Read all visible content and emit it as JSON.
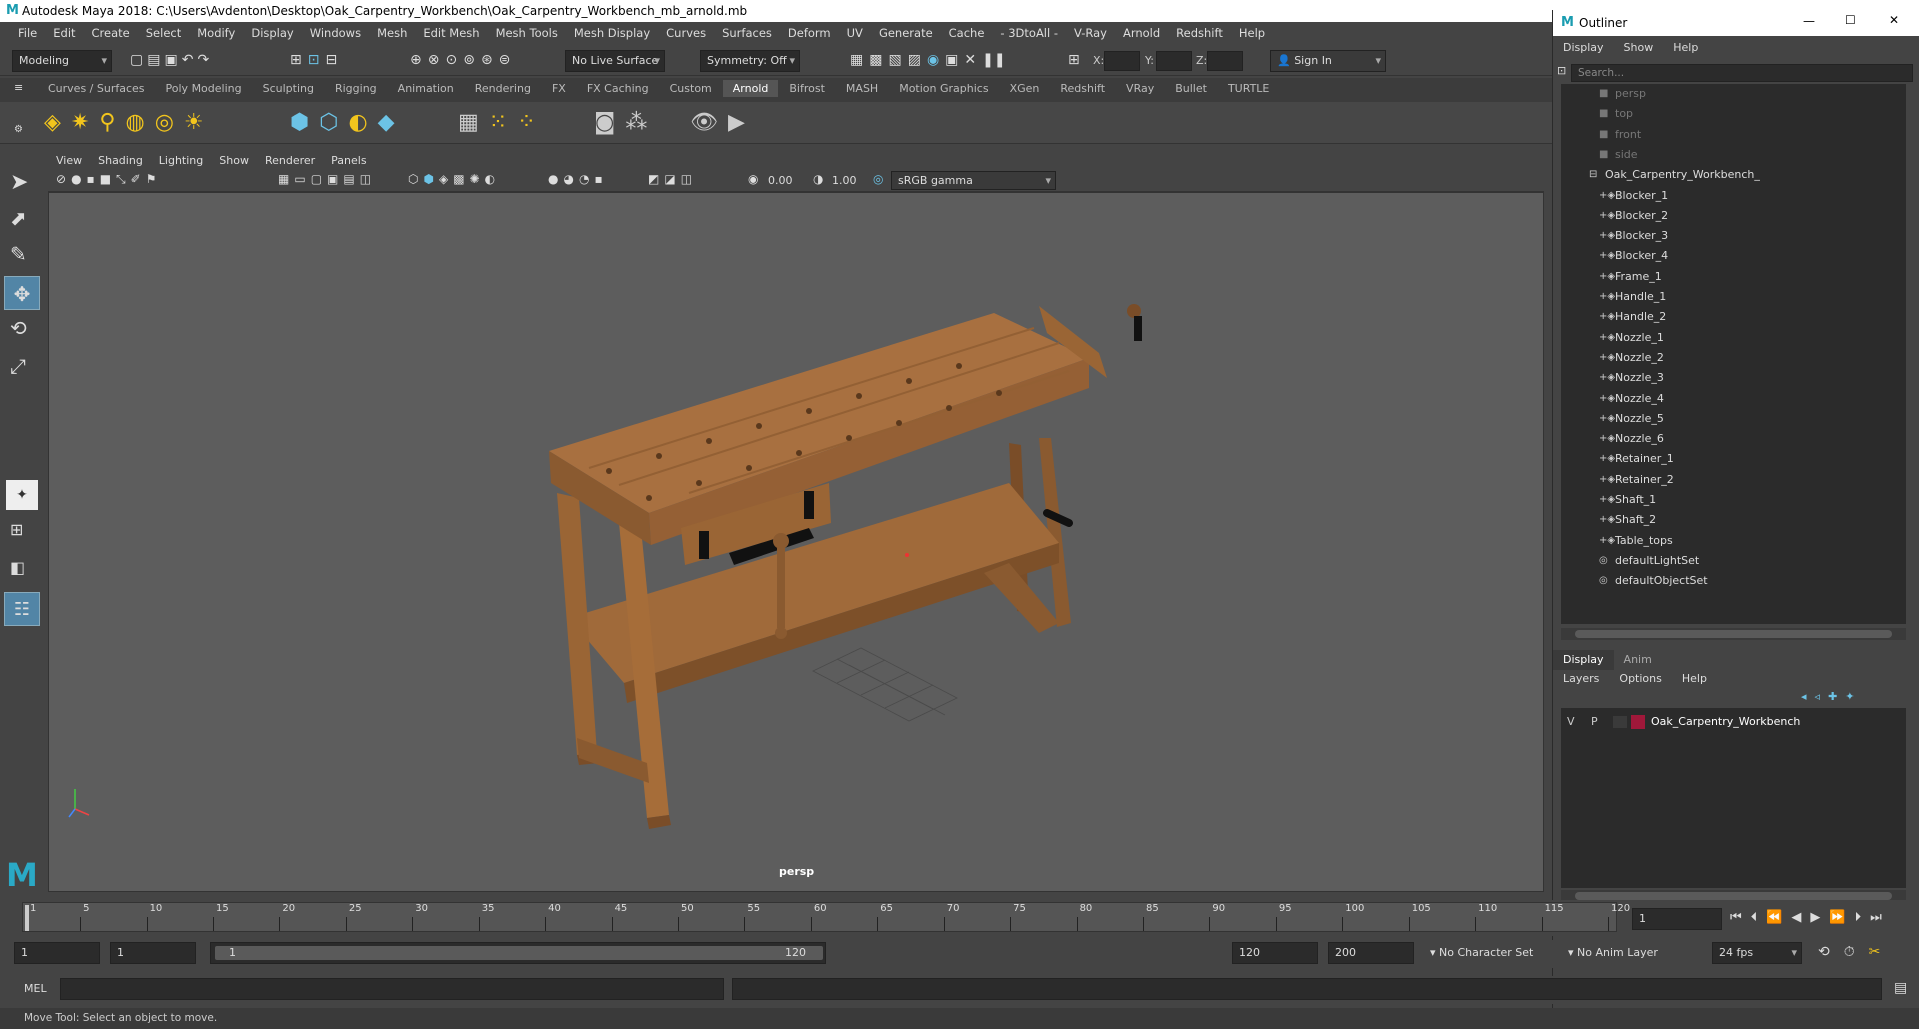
{
  "window": {
    "title": "Autodesk Maya 2018: C:\\Users\\Avdenton\\Desktop\\Oak_Carpentry_Workbench\\Oak_Carpentry_Workbench_mb_arnold.mb"
  },
  "menubar": [
    "File",
    "Edit",
    "Create",
    "Select",
    "Modify",
    "Display",
    "Windows",
    "Mesh",
    "Edit Mesh",
    "Mesh Tools",
    "Mesh Display",
    "Curves",
    "Surfaces",
    "Deform",
    "UV",
    "Generate",
    "Cache",
    "- 3DtoAll -",
    "V-Ray",
    "Arnold",
    "Redshift",
    "Help"
  ],
  "statusline": {
    "mode": "Modeling",
    "live_surface": "No Live Surface",
    "symmetry": "Symmetry: Off",
    "x_label": "X:",
    "y_label": "Y:",
    "z_label": "Z:",
    "sign_in": "Sign In"
  },
  "shelf_tabs": [
    "Curves / Surfaces",
    "Poly Modeling",
    "Sculpting",
    "Rigging",
    "Animation",
    "Rendering",
    "FX",
    "FX Caching",
    "Custom",
    "Arnold",
    "Bifrost",
    "MASH",
    "Motion Graphics",
    "XGen",
    "Redshift",
    "VRay",
    "Bullet",
    "TURTLE"
  ],
  "shelf_active": "Arnold",
  "viewport": {
    "menu": [
      "View",
      "Shading",
      "Lighting",
      "Show",
      "Renderer",
      "Panels"
    ],
    "exposure": "0.00",
    "gamma": "1.00",
    "color_space": "sRGB gamma",
    "camera_label": "persp"
  },
  "outliner": {
    "title": "Outliner",
    "menu": [
      "Display",
      "Show",
      "Help"
    ],
    "search_placeholder": "Search...",
    "cameras": [
      "persp",
      "top",
      "front",
      "side"
    ],
    "group": "Oak_Carpentry_Workbench_",
    "children": [
      "Blocker_1",
      "Blocker_2",
      "Blocker_3",
      "Blocker_4",
      "Frame_1",
      "Handle_1",
      "Handle_2",
      "Nozzle_1",
      "Nozzle_2",
      "Nozzle_3",
      "Nozzle_4",
      "Nozzle_5",
      "Nozzle_6",
      "Retainer_1",
      "Retainer_2",
      "Shaft_1",
      "Shaft_2",
      "Table_tops"
    ],
    "sets": [
      "defaultLightSet",
      "defaultObjectSet"
    ]
  },
  "layer_editor": {
    "tabs": [
      "Display",
      "Anim"
    ],
    "menu": [
      "Layers",
      "Options",
      "Help"
    ],
    "layer": {
      "v": "V",
      "p": "P",
      "name": "Oak_Carpentry_Workbench",
      "color": "#a0183a"
    }
  },
  "timeline": {
    "ticks": [
      "1",
      "5",
      "10",
      "15",
      "20",
      "25",
      "30",
      "35",
      "40",
      "45",
      "50",
      "55",
      "60",
      "65",
      "70",
      "75",
      "80",
      "85",
      "90",
      "95",
      "100",
      "105",
      "110",
      "115",
      "120"
    ],
    "current_frame": "1"
  },
  "range": {
    "start": "1",
    "playback_start": "1",
    "slider_start": "1",
    "slider_end": "120",
    "playback_end": "120",
    "end": "200",
    "character_set": "No Character Set",
    "anim_layer": "No Anim Layer",
    "fps": "24 fps"
  },
  "cmdline": {
    "label": "MEL"
  },
  "helpline": {
    "text": "Move Tool: Select an object to move."
  }
}
